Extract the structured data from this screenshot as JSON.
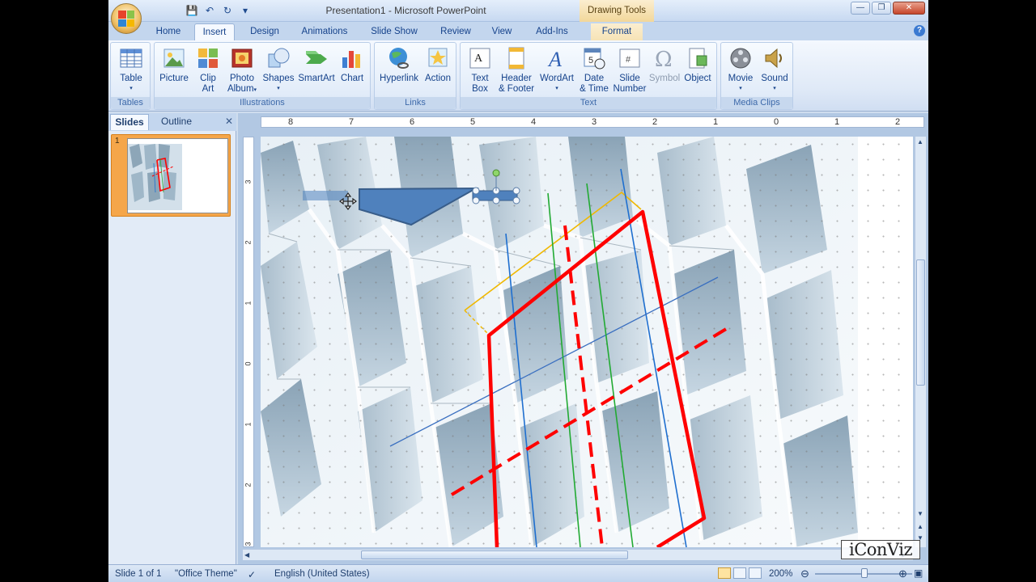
{
  "window": {
    "title": "Presentation1 - Microsoft PowerPoint",
    "context_tab": "Drawing Tools",
    "controls": [
      "minimize",
      "restore",
      "close"
    ]
  },
  "qat": {
    "icons": [
      "save-icon",
      "undo-icon",
      "redo-icon",
      "customize-icon"
    ]
  },
  "tabs": [
    "Home",
    "Insert",
    "Design",
    "Animations",
    "Slide Show",
    "Review",
    "View",
    "Add-Ins",
    "Format"
  ],
  "active_tab": "Insert",
  "ribbon": {
    "groups": [
      {
        "label": "Tables",
        "buttons": [
          "Table"
        ]
      },
      {
        "label": "Illustrations",
        "buttons": [
          "Picture",
          "Clip Art",
          "Photo Album",
          "Shapes",
          "SmartArt",
          "Chart"
        ]
      },
      {
        "label": "Links",
        "buttons": [
          "Hyperlink",
          "Action"
        ]
      },
      {
        "label": "Text",
        "buttons": [
          "Text Box",
          "Header & Footer",
          "WordArt",
          "Date & Time",
          "Slide Number",
          "Symbol",
          "Object"
        ]
      },
      {
        "label": "Media Clips",
        "buttons": [
          "Movie",
          "Sound"
        ]
      }
    ],
    "labels": {
      "table_1": "Table",
      "picture": "Picture",
      "clipart_1": "Clip",
      "clipart_2": "Art",
      "photo_1": "Photo",
      "photo_2": "Album",
      "shapes": "Shapes",
      "smartart": "SmartArt",
      "chart": "Chart",
      "hyperlink": "Hyperlink",
      "action": "Action",
      "textbox_1": "Text",
      "textbox_2": "Box",
      "header_1": "Header",
      "header_2": "& Footer",
      "wordart": "WordArt",
      "date_1": "Date",
      "date_2": "& Time",
      "slidenum_1": "Slide",
      "slidenum_2": "Number",
      "symbol": "Symbol",
      "object": "Object",
      "movie": "Movie",
      "sound": "Sound"
    }
  },
  "pane": {
    "tabs": [
      "Slides",
      "Outline"
    ],
    "active": "Slides",
    "thumb_number": "1"
  },
  "rulers": {
    "horizontal": [
      "8",
      "7",
      "6",
      "5",
      "4",
      "3",
      "2",
      "1",
      "0",
      "1",
      "2"
    ],
    "vertical": [
      "3",
      "2",
      "1",
      "0",
      "1",
      "2",
      "3"
    ]
  },
  "status": {
    "slide": "Slide 1 of 1",
    "theme": "\"Office Theme\"",
    "language": "English (United States)",
    "zoom": "200%"
  },
  "watermark": "iConViz",
  "colors": {
    "selection_shape": "#4f81bd",
    "guide_red": "#ff0000",
    "guide_green": "#22aa33",
    "guide_blue": "#1f6fcf",
    "guide_yellow": "#f0b800"
  }
}
